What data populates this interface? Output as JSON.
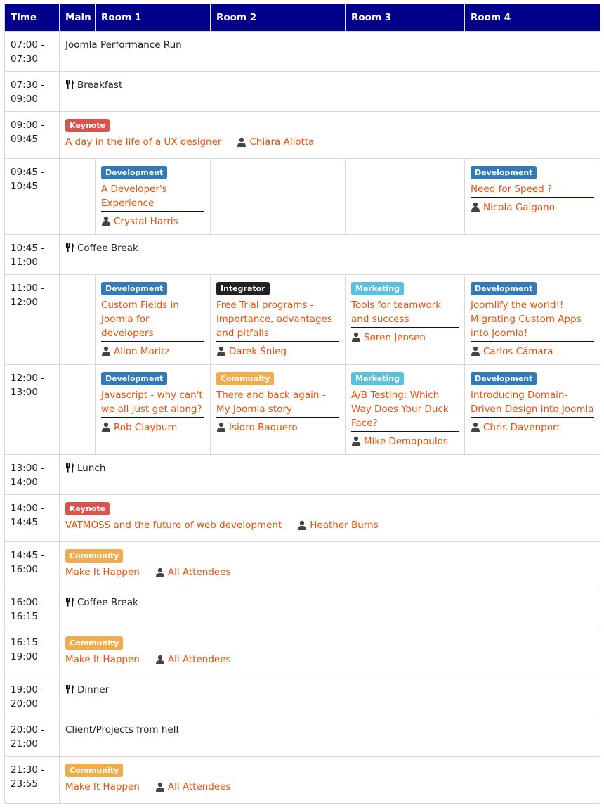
{
  "headers": [
    "Time",
    "Main",
    "Room 1",
    "Room 2",
    "Room 3",
    "Room 4"
  ],
  "colors": {
    "header_bg": "#00008b",
    "link": "#e8510a",
    "development": "#337ab7",
    "keynote": "#d9534f",
    "integrator": "#222222",
    "marketing": "#5bc0de",
    "community": "#f0ad4e"
  },
  "slots": {
    "s1": {
      "time": "07:00 - 07:30",
      "text": "Joomla Performance Run"
    },
    "s2": {
      "time": "07:30 - 09:00",
      "text": "Breakfast",
      "icon": "cutlery-icon"
    },
    "s3": {
      "time": "09:00 - 09:45",
      "badge": "Keynote",
      "title": "A day in the life of a UX designer",
      "speaker": "Chiara Aliotta"
    },
    "s4": {
      "time": "09:45 - 10:45",
      "room1": {
        "badge": "Development",
        "title": "A Developer's Experience",
        "speaker": "Crystal Harris"
      },
      "room4": {
        "badge": "Development",
        "title": "Need for Speed ?",
        "speaker": "Nicola Galgano"
      }
    },
    "s5": {
      "time": "10:45 - 11:00",
      "text": "Coffee Break",
      "icon": "cutlery-icon"
    },
    "s6": {
      "time": "11:00 - 12:00",
      "room1": {
        "badge": "Development",
        "title": "Custom Fields in Joomla for developers",
        "speaker": "Allon Moritz"
      },
      "room2": {
        "badge": "Integrator",
        "title": "Free Trial programs - importance, advantages and pitfalls",
        "speaker": "Darek Śnieg"
      },
      "room3": {
        "badge": "Marketing",
        "title": "Tools for teamwork and success",
        "speaker": "Søren Jensen"
      },
      "room4": {
        "badge": "Development",
        "title": "Joomlify the world!! Migrating Custom Apps into Joomla!",
        "speaker": "Carlos Cámara"
      }
    },
    "s7": {
      "time": "12:00 - 13:00",
      "room1": {
        "badge": "Development",
        "title": "Javascript - why can't we all just get along?",
        "speaker": "Rob Clayburn"
      },
      "room2": {
        "badge": "Community",
        "title": "There and back again - My Joomla story",
        "speaker": "Isidro Baquero"
      },
      "room3": {
        "badge": "Marketing",
        "title": "A/B Testing: Which Way Does Your Duck Face?",
        "speaker": "Mike Demopoulos"
      },
      "room4": {
        "badge": "Development",
        "title": "Introducing Domain-Driven Design into Joomla",
        "speaker": "Chris Davenport"
      }
    },
    "s8": {
      "time": "13:00 - 14:00",
      "text": "Lunch",
      "icon": "cutlery-icon"
    },
    "s9": {
      "time": "14:00 - 14:45",
      "badge": "Keynote",
      "title": "VATMOSS and the future of web development",
      "speaker": "Heather Burns"
    },
    "s10": {
      "time": "14:45 - 16:00",
      "badge": "Community",
      "title": "Make It Happen",
      "speaker": "All Attendees"
    },
    "s11": {
      "time": "16:00 - 16:15",
      "text": "Coffee Break",
      "icon": "cutlery-icon"
    },
    "s12": {
      "time": "16:15 - 19:00",
      "badge": "Community",
      "title": "Make It Happen",
      "speaker": "All Attendees"
    },
    "s13": {
      "time": "19:00 - 20:00",
      "text": "Dinner",
      "icon": "cutlery-icon"
    },
    "s14": {
      "time": "20:00 - 21:00",
      "text": "Client/Projects from hell"
    },
    "s15": {
      "time": "21:30 - 23:55",
      "badge": "Community",
      "title": "Make It Happen",
      "speaker": "All Attendees"
    }
  }
}
